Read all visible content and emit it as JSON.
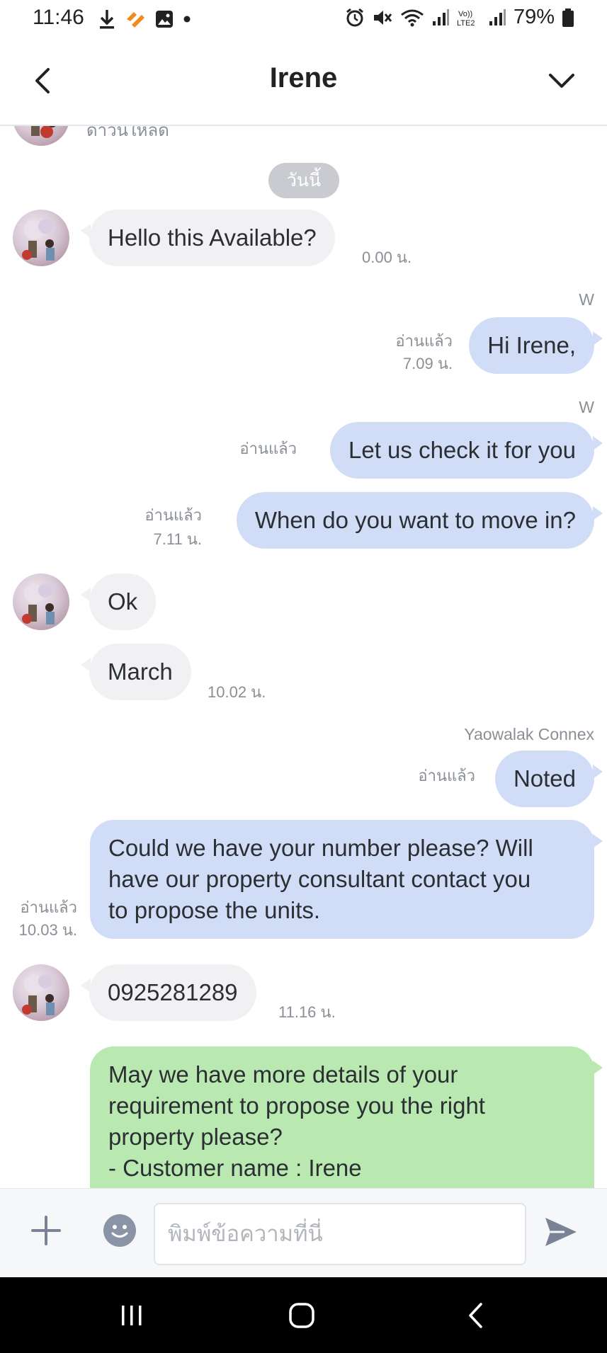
{
  "status_bar": {
    "time": "11:46",
    "battery": "79%"
  },
  "header": {
    "title": "Irene"
  },
  "chat": {
    "cut_off_text": "ดำวันใหลด",
    "date_divider": "วันนี้",
    "messages": [
      {
        "id": "m1",
        "direction": "in",
        "text": "Hello this Available?",
        "time": "0.00 น."
      },
      {
        "id": "m2",
        "direction": "out",
        "sender": "W",
        "text": "Hi Irene,",
        "read": "อ่านแล้ว",
        "time": "7.09 น."
      },
      {
        "id": "m3",
        "direction": "out",
        "sender": "W",
        "text": "Let us check it for you",
        "read": "อ่านแล้ว"
      },
      {
        "id": "m4",
        "direction": "out",
        "text": "When do you want to move in?",
        "read": "อ่านแล้ว",
        "time": "7.11 น."
      },
      {
        "id": "m5",
        "direction": "in",
        "text": "Ok"
      },
      {
        "id": "m6",
        "direction": "in",
        "text": "March",
        "time": "10.02 น."
      },
      {
        "id": "m7",
        "direction": "out",
        "sender": "Yaowalak Connex",
        "text": "Noted",
        "read": "อ่านแล้ว"
      },
      {
        "id": "m8",
        "direction": "out",
        "lines": [
          "Could we have your number please? Will",
          "have our property consultant contact you",
          "to propose the units."
        ],
        "read": "อ่านแล้ว",
        "time": "10.03 น."
      },
      {
        "id": "m9",
        "direction": "in",
        "text": "0925281289",
        "time": "11.16 น."
      },
      {
        "id": "m10",
        "direction": "out",
        "style": "green",
        "lines": [
          "May we have more details of your",
          "requirement to propose you the right",
          "property please?",
          "- Customer name : Irene"
        ]
      }
    ]
  },
  "input_bar": {
    "placeholder": "พิมพ์ข้อความที่นี่"
  },
  "colors": {
    "incoming_bubble": "#f1f1f3",
    "outgoing_bubble": "#d1dcf6",
    "green_bubble": "#b9e9b1",
    "meta_text": "#8a8f96",
    "send_icon": "#7a8396"
  },
  "icons": [
    "back-arrow-icon",
    "chevron-down-icon",
    "plus-icon",
    "emoji-icon",
    "send-icon",
    "download-icon",
    "image-icon",
    "alarm-icon",
    "mute-icon",
    "wifi-icon",
    "signal-icon",
    "battery-icon",
    "recents-icon",
    "home-icon",
    "nav-back-icon"
  ]
}
